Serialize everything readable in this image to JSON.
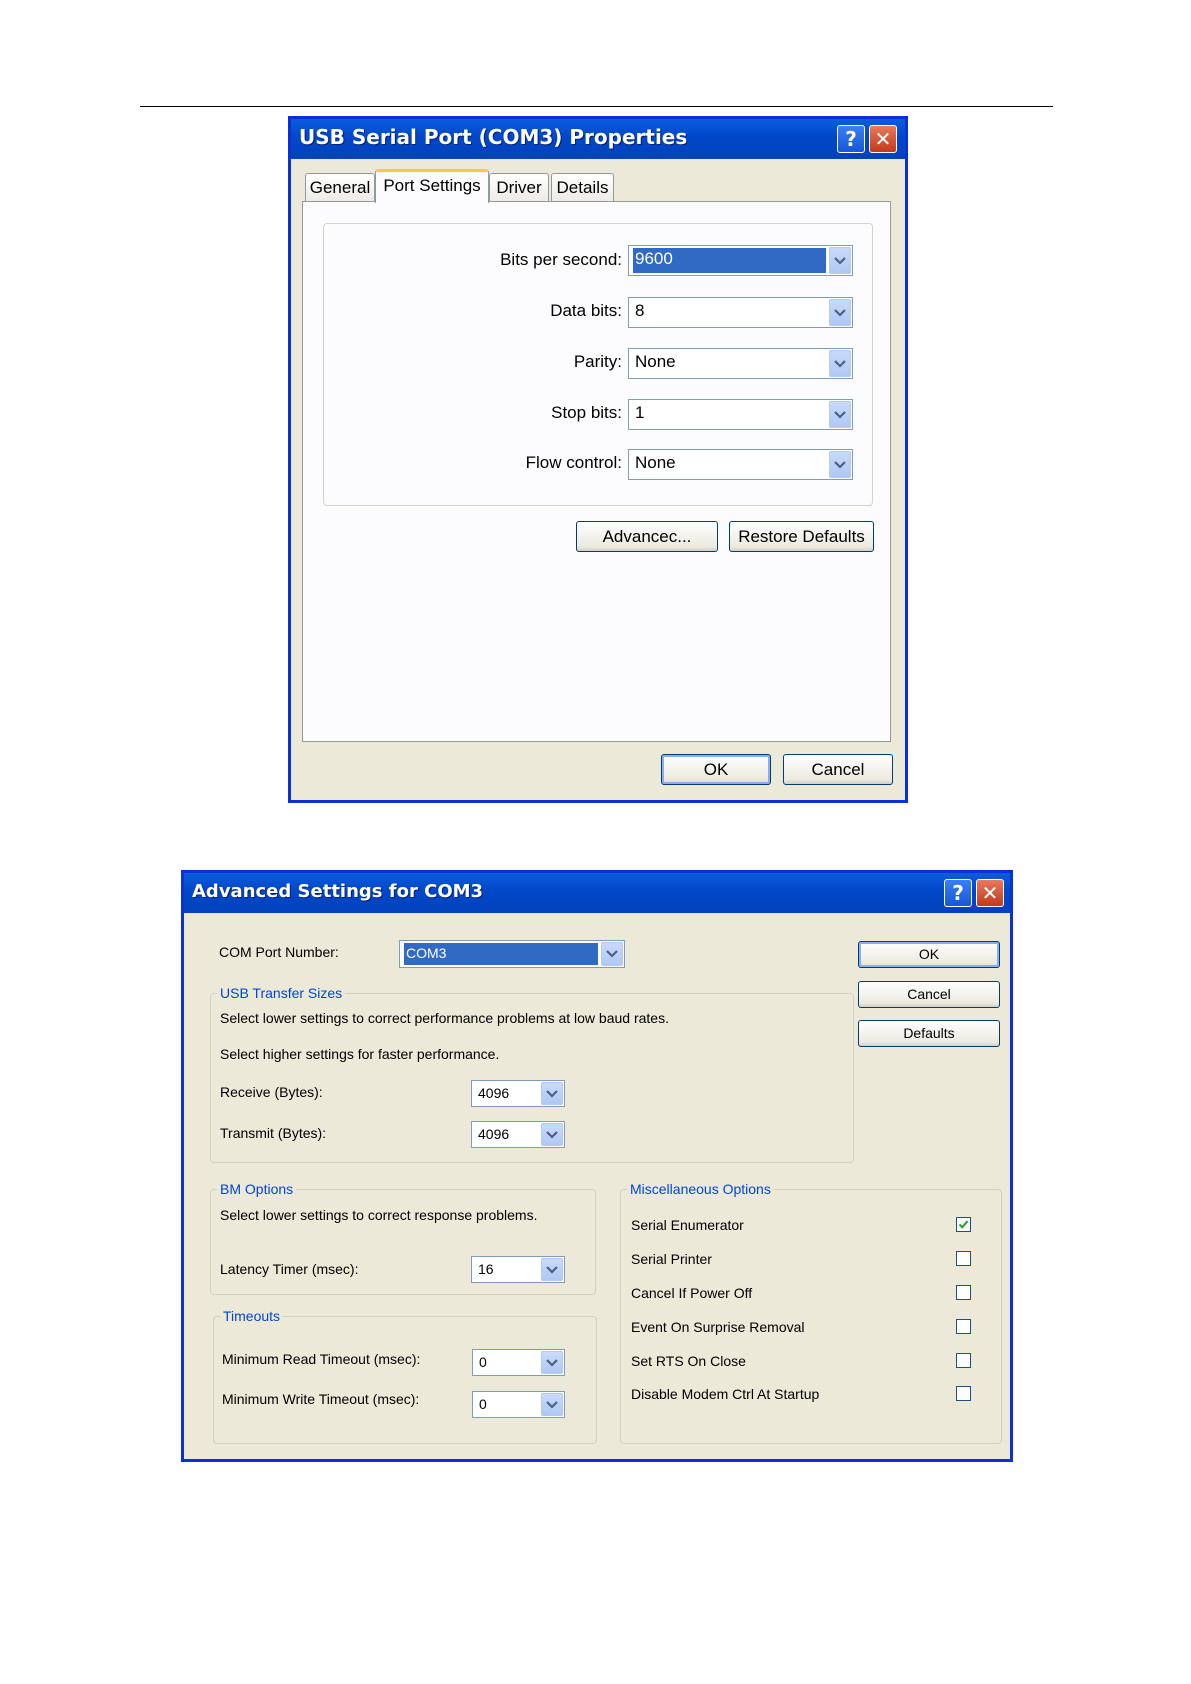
{
  "dialog1": {
    "title": "USB Serial Port (COM3) Properties",
    "help_button": "?",
    "close_button": "✕",
    "tabs": [
      "General",
      "Port Settings",
      "Driver",
      "Details"
    ],
    "fields": [
      {
        "label": "Bits per second:",
        "value": "9600"
      },
      {
        "label": "Data bits:",
        "value": "8"
      },
      {
        "label": "Parity:",
        "value": "None"
      },
      {
        "label": "Stop bits:",
        "value": "1"
      },
      {
        "label": "Flow control:",
        "value": "None"
      }
    ],
    "advanced_button": "Advancec...",
    "restore_button": "Restore Defaults",
    "ok_button": "OK",
    "cancel_button": "Cancel"
  },
  "dialog2": {
    "title": "Advanced Settings for COM3",
    "help_button": "?",
    "close_button": "✕",
    "com_port": {
      "label": "COM Port Number:",
      "value": "COM3"
    },
    "usb_transfer": {
      "title": "USB Transfer Sizes",
      "line1": "Select lower settings to correct performance problems at low baud rates.",
      "line2": "Select higher settings for faster performance.",
      "receive_label": "Receive (Bytes):",
      "receive_value": "4096",
      "transmit_label": "Transmit (Bytes):",
      "transmit_value": "4096"
    },
    "bm_options": {
      "title": "BM Options",
      "line1": "Select lower settings to correct response problems.",
      "latency_label": "Latency Timer (msec):",
      "latency_value": "16"
    },
    "timeouts": {
      "title": "Timeouts",
      "read_label": "Minimum Read Timeout (msec):",
      "read_value": "0",
      "write_label": "Minimum Write Timeout (msec):",
      "write_value": "0"
    },
    "misc": {
      "title": "Miscellaneous Options",
      "options": [
        {
          "label": "Serial Enumerator",
          "checked": true
        },
        {
          "label": "Serial Printer",
          "checked": false
        },
        {
          "label": "Cancel If Power Off",
          "checked": false
        },
        {
          "label": "Event On Surprise Removal",
          "checked": false
        },
        {
          "label": "Set RTS On Close",
          "checked": false
        },
        {
          "label": "Disable Modem Ctrl At Startup",
          "checked": false
        }
      ]
    },
    "ok_button": "OK",
    "cancel_button": "Cancel",
    "defaults_button": "Defaults"
  },
  "icons": {
    "dropdown": "chevron-down-icon",
    "checkbox_checked": "checkmark-icon"
  },
  "colors": {
    "title_bar": "#0a5ddb",
    "dialog_face": "#ece9d8",
    "selection": "#316ac5",
    "group_title": "#0046d5"
  }
}
